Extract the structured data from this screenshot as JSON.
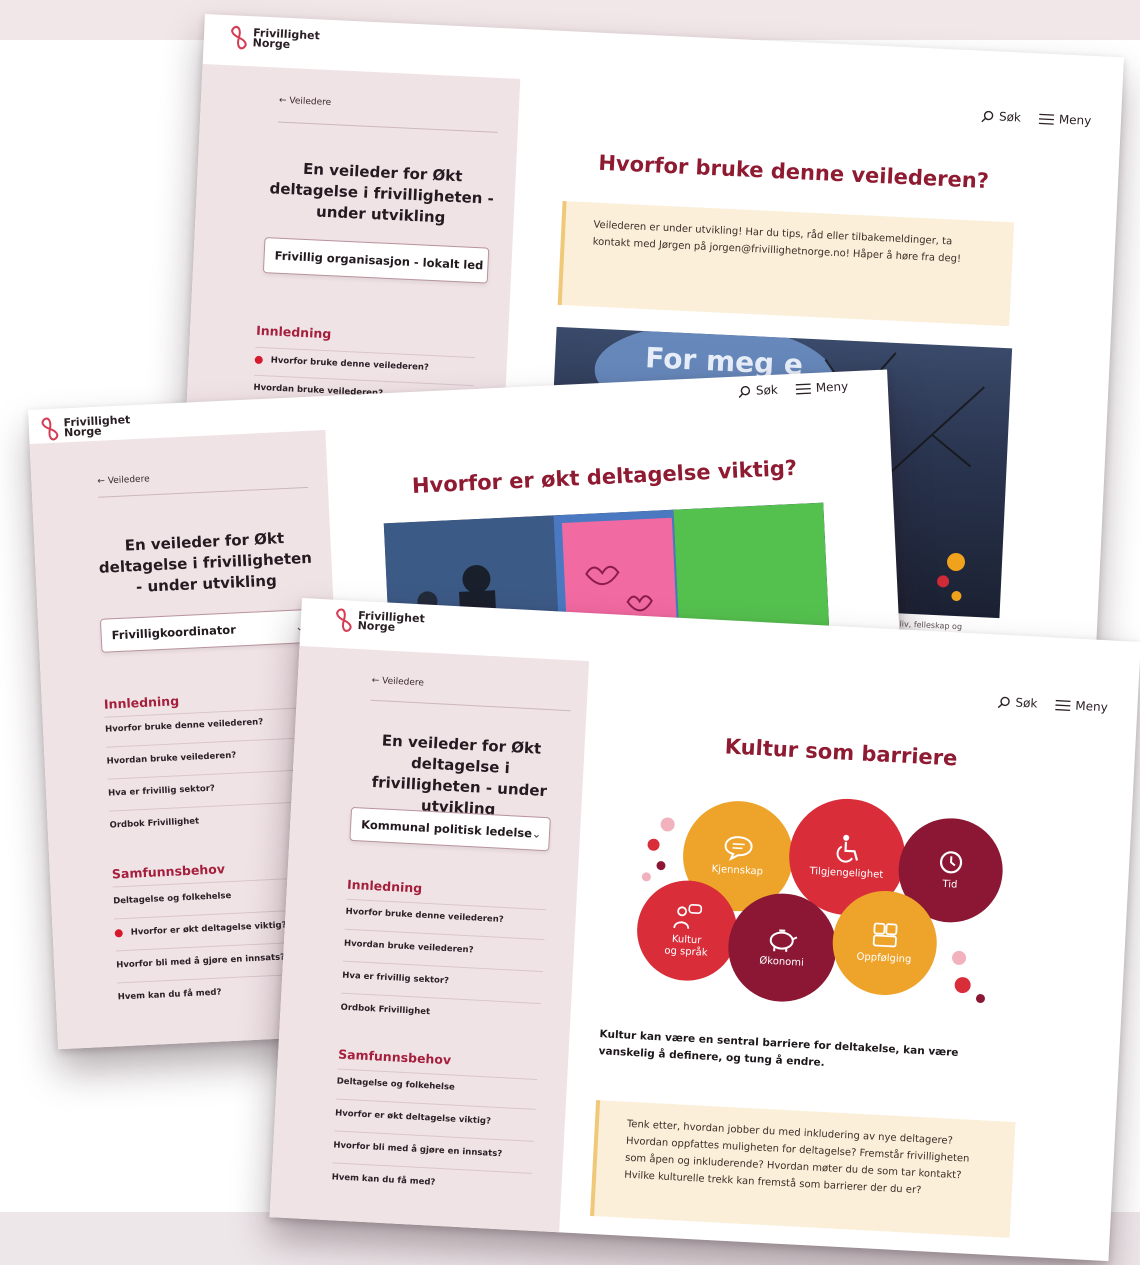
{
  "brand": {
    "logo_line1": "Frivillighet",
    "logo_line2": "Norge",
    "logo_color": "#d43d55"
  },
  "topbar": {
    "search_label": "Søk",
    "menu_label": "Meny"
  },
  "sidebar": {
    "back_label": "← Veiledere",
    "guide_title": "En veileder for Økt deltagelse i frivilligheten - under utvikling"
  },
  "screen1": {
    "role_select": "Frivillig organisasjon - lokalt led",
    "section_head": "Innledning",
    "nav": [
      "Hvorfor bruke denne veilederen?",
      "Hvordan bruke veilederen?"
    ],
    "page_title": "Hvorfor bruke denne veilederen?",
    "notice": "Veilederen er under utvikling! Har du tips, råd eller tilbakemeldinger, ta kontakt med Jørgen på jorgen@frivillighetnorge.no! Håper å høre fra deg!",
    "photo_text": "For meg e",
    "caption": "gode liv, felleskap og"
  },
  "screen2": {
    "role_select": "Frivilligkoordinator",
    "section1_head": "Innledning",
    "section1_items": [
      "Hvorfor bruke denne veilederen?",
      "Hvordan bruke veilederen?",
      "Hva er frivillig sektor?",
      "Ordbok Frivillighet"
    ],
    "section2_head": "Samfunnsbehov",
    "section2_items": [
      "Deltagelse og folkehelse",
      "Hvorfor er økt deltagelse viktig?",
      "Hvorfor bli med å gjøre en innsats?",
      "Hvem kan du få med?"
    ],
    "page_title": "Hvorfor er økt deltagelse viktig?"
  },
  "screen3": {
    "role_select": "Kommunal politisk ledelse",
    "section1_head": "Innledning",
    "section1_items": [
      "Hvorfor bruke denne veilederen?",
      "Hvordan bruke veilederen?",
      "Hva er frivillig sektor?",
      "Ordbok Frivillighet"
    ],
    "section2_head": "Samfunnsbehov",
    "section2_items": [
      "Deltagelse og folkehelse",
      "Hvorfor er økt deltagelse viktig?",
      "Hvorfor bli med å gjøre en innsats?",
      "Hvem kan du få med?"
    ],
    "page_title": "Kultur som barriere",
    "bubbles": {
      "kjennskap": "Kjennskap",
      "tilgjengelighet": "Tilgjengelighet",
      "tid": "Tid",
      "kultur_line1": "Kultur",
      "kultur_line2": "og språk",
      "okonomi": "Økonomi",
      "oppfolging": "Oppfølging"
    },
    "intro": "Kultur kan være en sentral barriere for deltakelse, kan være vanskelig å definere, og tung å endre.",
    "reflection": "Tenk etter, hvordan jobber du med inkludering av nye deltagere? Hvordan oppfattes muligheten for deltagelse? Fremstår frivilligheten som åpen og inkluderende? Hvordan møter du de som tar kontakt? Hvilke kulturelle trekk kan fremstå som barrierer der du er?"
  },
  "colors": {
    "accent": "#8f1b32",
    "orange": "#eea32a",
    "red": "#d92d3a",
    "maroon": "#8b1734",
    "notice_bg": "#fbefd9",
    "sidebar_bg": "#f0e3e6"
  }
}
